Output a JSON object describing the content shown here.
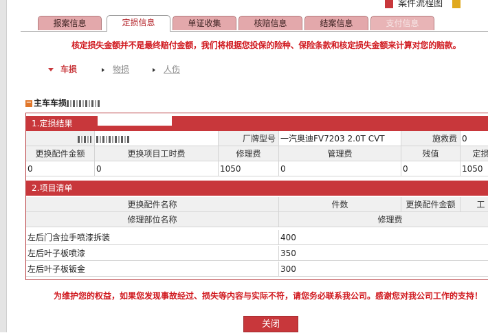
{
  "topbar": {
    "label": "案件流程图"
  },
  "tabs": [
    {
      "label": "报案信息",
      "state": "normal"
    },
    {
      "label": "定损信息",
      "state": "active"
    },
    {
      "label": "单证收集",
      "state": "normal"
    },
    {
      "label": "核赔信息",
      "state": "normal"
    },
    {
      "label": "结案信息",
      "state": "normal"
    },
    {
      "label": "支付信息",
      "state": "disabled"
    }
  ],
  "notice": "核定损失金额并不是最终赔付金额，我们将根据您投保的险种、保险条款和核定损失金额来计算对您的赔款。",
  "subnav": {
    "vehicle": "车损",
    "property": "物损",
    "injury": "人伤"
  },
  "section_title": "主车车损",
  "loss_result": {
    "header": "1.定损结果",
    "brand_label": "厂牌型号",
    "brand_value": "一汽奥迪FV7203 2.0T CVT",
    "rescue_label": "施救费",
    "rescue_value": "0",
    "columns": [
      "更换配件金额",
      "更换项目工时费",
      "修理费",
      "管理费",
      "残值",
      "定损"
    ],
    "values": [
      "0",
      "0",
      "1050",
      "0",
      "0",
      "1050"
    ]
  },
  "items": {
    "header": "2.项目清单",
    "parts_columns": [
      "更换配件名称",
      "件数",
      "更换配件金额",
      "工"
    ],
    "repair_columns": [
      "修理部位名称",
      "修理费"
    ],
    "repair_rows": [
      {
        "name": "左后门含拉手喷漆拆装",
        "fee": "400"
      },
      {
        "name": "左后叶子板喷漆",
        "fee": "350"
      },
      {
        "name": "左后叶子板钣金",
        "fee": "300"
      }
    ]
  },
  "bottom_notice": "为维护您的权益，如果您发现事故经过、损失等内容与实际不符，请您务必联系我公司。感谢您对我公司工作的支持！",
  "close_label": "关闭",
  "colors": {
    "accent": "#c8373b",
    "tab": "#e3a8ab",
    "notice": "#d0181e"
  }
}
